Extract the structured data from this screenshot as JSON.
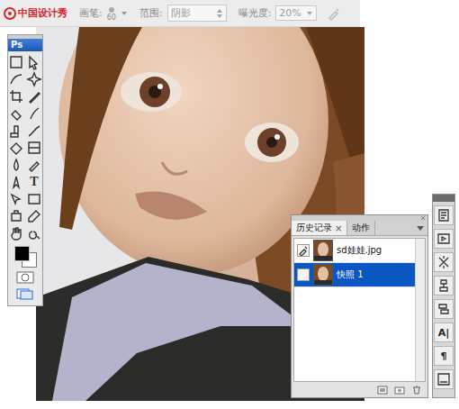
{
  "logo": {
    "title": "中国设计秀"
  },
  "options_bar": {
    "brush_label": "画笔:",
    "brush_size": "60",
    "range_label": "范围:",
    "range_value": "阴影",
    "exposure_label": "曝光度:",
    "exposure_value": "20%"
  },
  "toolbox": {
    "title": "Ps",
    "text_tool": "T"
  },
  "history_panel": {
    "close_glyph": "×",
    "tabs": [
      {
        "label": "历史记录",
        "selected": true,
        "closable": true
      },
      {
        "label": "动作",
        "selected": false,
        "closable": false
      }
    ],
    "states": [
      {
        "label": "sd娃娃.jpg",
        "source": true,
        "selected": false
      },
      {
        "label": "快照 1",
        "source": false,
        "selected": true
      }
    ]
  },
  "dock": {
    "items": [
      {
        "kind": "icon",
        "glyph": ""
      },
      {
        "kind": "icon",
        "glyph": ""
      },
      {
        "kind": "icon",
        "glyph": ""
      },
      {
        "kind": "icon",
        "glyph": ""
      },
      {
        "kind": "icon",
        "glyph": ""
      },
      {
        "kind": "glyph",
        "glyph": "A|"
      },
      {
        "kind": "glyph",
        "glyph": "¶"
      },
      {
        "kind": "icon",
        "glyph": ""
      }
    ]
  }
}
